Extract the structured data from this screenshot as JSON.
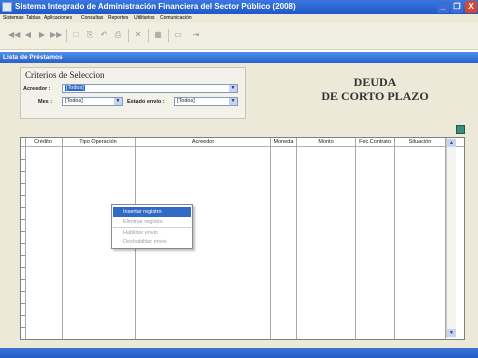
{
  "window": {
    "title": "Sistema Integrado de Administración Financiera del Sector Público (2008)",
    "min_label": "_",
    "restore_label": "❐",
    "close_label": "X"
  },
  "menubar": [
    "Sistemas",
    "Tablas",
    "Aplicaciones",
    "Consultas",
    "Reportes",
    "Utilitarios",
    "Comunicación"
  ],
  "toolbar": {
    "first": "◀◀",
    "prev": "◀",
    "next": "▶",
    "last": "▶▶",
    "new": "□",
    "copy": "⎘",
    "undo": "↶",
    "print": "⎙",
    "delete": "✕",
    "save": "▦",
    "close": "▭",
    "exit": "⇥"
  },
  "form": {
    "title": "Lista de Préstamos"
  },
  "criteria": {
    "title": "Criterios de Seleccion",
    "acreedor_label": "Acreedor :",
    "acreedor_value": "[Todos]",
    "mes_label": "Mes :",
    "mes_value": "[Todos]",
    "estado_label": "Estado envio :",
    "estado_value": "[Todos]",
    "arrow": "▼"
  },
  "heading": {
    "line1": "DEUDA",
    "line2": "DE CORTO PLAZO"
  },
  "table": {
    "columns": [
      "Crédito",
      "Tipo Operación",
      "Acreedor",
      "Moneda",
      "Monto",
      "Fec.Contrato",
      "Situación"
    ],
    "rows": []
  },
  "scroll": {
    "up": "▲",
    "down": "▼"
  },
  "context_menu": {
    "items": [
      "Insertar registro",
      "Eliminar registro",
      "Habilitar envio",
      "Deshabilitar envio"
    ]
  },
  "colors": {
    "title_bar": "#245edc",
    "form_bar": "#3a7ae0",
    "selection": "#316ac5",
    "form_bg": "#ece9d8"
  }
}
